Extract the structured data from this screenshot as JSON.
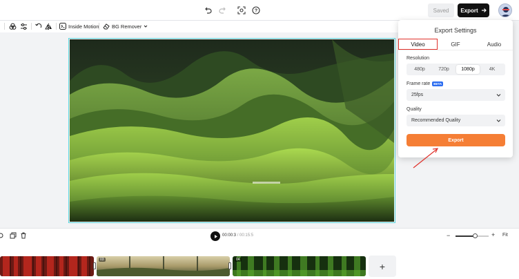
{
  "topbar": {
    "saved_label": "Saved",
    "export_label": "Export"
  },
  "toolbar": {
    "inside_motion_label": "Inside Motion",
    "bg_remover_label": "BG Remover"
  },
  "export_panel": {
    "title": "Export Settings",
    "tabs": [
      {
        "label": "Video",
        "active": true
      },
      {
        "label": "GIF",
        "active": false
      },
      {
        "label": "Audio",
        "active": false
      }
    ],
    "resolution_label": "Resolution",
    "resolutions": [
      "480p",
      "720p",
      "1080p",
      "4K"
    ],
    "selected_resolution": "1080p",
    "frame_rate_label": "Frame rate",
    "beta_badge": "BETA",
    "frame_rate_value": "25fps",
    "quality_label": "Quality",
    "quality_value": "Recommended Quality",
    "export_button": "Export"
  },
  "timeline": {
    "current_time": "00:00:3",
    "separator": "/",
    "total_time": "00:15:5",
    "zoom_level": 0.6,
    "fit_label": "Fit",
    "clips": [
      {
        "number": "",
        "theme": "red-forest"
      },
      {
        "number": "03",
        "theme": "sunset-field"
      },
      {
        "number": "04",
        "theme": "green-forest"
      }
    ],
    "add_clip_label": "+"
  },
  "colors": {
    "accent_orange": "#f57e35",
    "active_tab_border": "#e0302a",
    "canvas_border": "#5ad6de",
    "export_dark": "#111111"
  }
}
